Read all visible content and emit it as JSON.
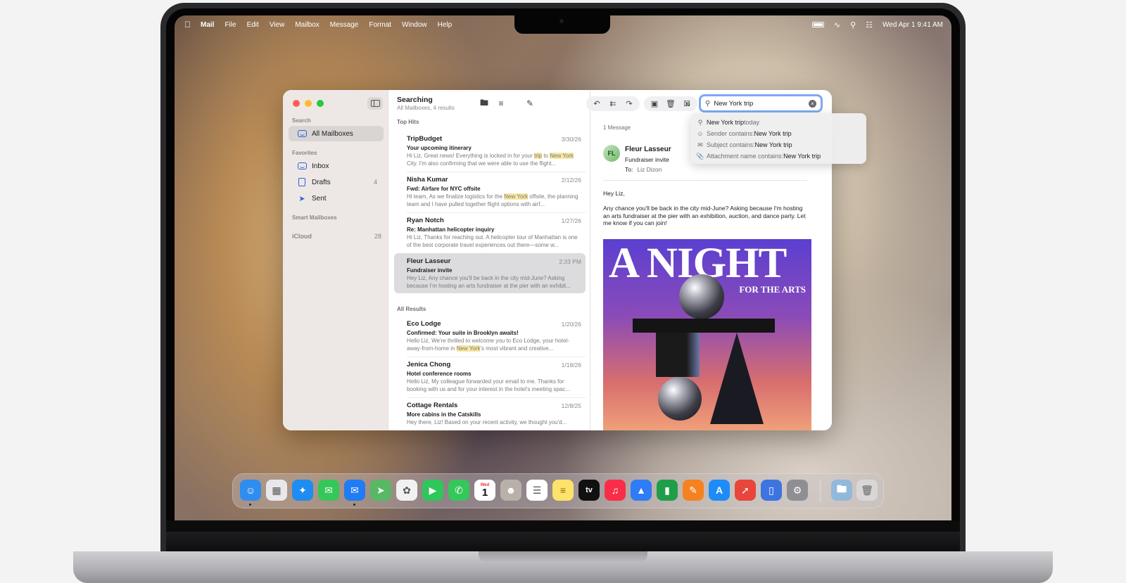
{
  "menubar": {
    "app": "Mail",
    "items": [
      "File",
      "Edit",
      "View",
      "Mailbox",
      "Message",
      "Format",
      "Window",
      "Help"
    ],
    "clock": "Wed Apr 1  9:41 AM"
  },
  "sidebar": {
    "search_heading": "Search",
    "all_mailboxes": "All Mailboxes",
    "favorites_heading": "Favorites",
    "inbox": "Inbox",
    "drafts": "Drafts",
    "drafts_count": "4",
    "sent": "Sent",
    "smart_heading": "Smart Mailboxes",
    "icloud": "iCloud",
    "icloud_count": "28"
  },
  "list": {
    "title": "Searching",
    "subtitle": "All Mailboxes, 4 results",
    "top_hits": "Top Hits",
    "all_results": "All Results",
    "top": [
      {
        "from": "TripBudget",
        "date": "3/30/26",
        "subject": "Your upcoming itinerary",
        "p1": "Hi Liz, Great news! Everything is locked in for your ",
        "h1": "trip",
        "p2": " to ",
        "h2": "New York",
        "p3": " City. I'm also confirming that we were able to use the flight..."
      },
      {
        "from": "Nisha Kumar",
        "date": "2/12/26",
        "subject": "Fwd: Airfare for NYC offsite",
        "p1": "Hi team, As we finalize logistics for the ",
        "h1": "New York",
        "p2": " offsite, the planning team and I have pulled together flight options with airf...",
        "h2": "",
        "p3": ""
      },
      {
        "from": "Ryan Notch",
        "date": "1/27/26",
        "subject": "Re: Manhattan helicopter inquiry",
        "p1": "Hi Liz, Thanks for reaching out. A helicopter tour of Manhattan is one of the best corporate travel experiences out there—some w...",
        "h1": "",
        "p2": "",
        "h2": "",
        "p3": ""
      },
      {
        "from": "Fleur Lasseur",
        "date": "2:33 PM",
        "subject": "Fundraiser invite",
        "p1": "Hey Liz, Any chance you'll be back in the city mid-June? Asking because I'm hosting an arts fundraiser at the pier with an exhibit...",
        "h1": "",
        "p2": "",
        "h2": "",
        "p3": ""
      }
    ],
    "all": [
      {
        "from": "Eco Lodge",
        "date": "1/20/26",
        "subject": "Confirmed: Your suite in Brooklyn awaits!",
        "p1": "Hello Liz, We're thrilled to welcome you to Eco Lodge, your hotel-away-from-home in ",
        "h1": "New York",
        "p2": "'s most vibrant and creative...",
        "h2": "",
        "p3": ""
      },
      {
        "from": "Jenica Chong",
        "date": "1/18/26",
        "subject": "Hotel conference rooms",
        "p1": "Hello Liz, My colleague forwarded your email to me. Thanks for booking with us and for your interest in the hotel's meeting spac...",
        "h1": "",
        "p2": "",
        "h2": "",
        "p3": ""
      },
      {
        "from": "Cottage Rentals",
        "date": "12/8/25",
        "subject": "More cabins in the Catskills",
        "p1": "Hey there, Liz! Based on your recent activity, we thought you'd...",
        "h1": "",
        "p2": "",
        "h2": "",
        "p3": ""
      }
    ]
  },
  "reader": {
    "count": "1 Message",
    "from": "Fleur Lasseur",
    "subject": "Fundraiser invite",
    "to_label": "To:",
    "to": "Liz Dizon",
    "greeting": "Hey Liz,",
    "body": "Any chance you'll be back in the city mid-June? Asking because I'm hosting an arts fundraiser at the pier with an exhibition, auction, and dance party. Let me know if you can join!",
    "poster_title": "A NIGHT",
    "poster_sub": "FOR THE ARTS"
  },
  "search": {
    "value": "New York trip",
    "suggestions": [
      {
        "icon": "search-icon",
        "a": "New York trip",
        "b": " today"
      },
      {
        "icon": "person-icon",
        "a": "Sender contains: ",
        "b": "New York trip"
      },
      {
        "icon": "envelope-icon",
        "a": "Subject contains: ",
        "b": "New York trip"
      },
      {
        "icon": "paperclip-icon",
        "a": "Attachment name contains: ",
        "b": "New York trip"
      }
    ]
  },
  "dock": {
    "calendar_day": "Wed",
    "calendar_date": "1",
    "apps": [
      {
        "name": "finder",
        "color": "#2f8df0",
        "glyph": "☺",
        "running": true
      },
      {
        "name": "launchpad",
        "color": "#e8e8ec",
        "glyph": "▦",
        "running": false
      },
      {
        "name": "safari",
        "color": "#1e8cf0",
        "glyph": "✦",
        "running": false
      },
      {
        "name": "messages",
        "color": "#35c759",
        "glyph": "✉",
        "running": false
      },
      {
        "name": "mail",
        "color": "#1f7cf5",
        "glyph": "✉",
        "running": true
      },
      {
        "name": "maps",
        "color": "#58b866",
        "glyph": "➤",
        "running": false
      },
      {
        "name": "photos",
        "color": "#f1f1f1",
        "glyph": "✿",
        "running": false
      },
      {
        "name": "facetime",
        "color": "#2fc65a",
        "glyph": "▶",
        "running": false
      },
      {
        "name": "phone",
        "color": "#34c759",
        "glyph": "✆",
        "running": false
      },
      {
        "name": "calendar",
        "color": "#ffffff",
        "glyph": "",
        "running": false
      },
      {
        "name": "contacts",
        "color": "#b7b1a9",
        "glyph": "☻",
        "running": false
      },
      {
        "name": "reminders",
        "color": "#ffffff",
        "glyph": "☰",
        "running": false
      },
      {
        "name": "notes",
        "color": "#fde36b",
        "glyph": "≡",
        "running": false
      },
      {
        "name": "tv",
        "color": "#111111",
        "glyph": "tv",
        "running": false
      },
      {
        "name": "music",
        "color": "#fa2d48",
        "glyph": "♫",
        "running": false
      },
      {
        "name": "keynote",
        "color": "#2e7cf6",
        "glyph": "▲",
        "running": false
      },
      {
        "name": "numbers",
        "color": "#1f9e4a",
        "glyph": "▮",
        "running": false
      },
      {
        "name": "pages",
        "color": "#f5821f",
        "glyph": "✎",
        "running": false
      },
      {
        "name": "app-store",
        "color": "#1d8cf8",
        "glyph": "A",
        "running": false
      },
      {
        "name": "rocket",
        "color": "#e8463a",
        "glyph": "➚",
        "running": false
      },
      {
        "name": "iphone-mirroring",
        "color": "#3d74e0",
        "glyph": "▯",
        "running": false
      },
      {
        "name": "system-settings",
        "color": "#8e8e93",
        "glyph": "⚙",
        "running": false
      }
    ]
  }
}
